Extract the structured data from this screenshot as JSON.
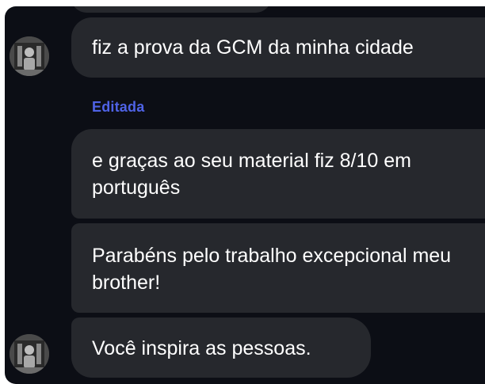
{
  "chat": {
    "messages": [
      {
        "text": "fiz a prova da GCM da minha cidade"
      },
      {
        "text": "e graças ao seu material fiz 8/10 em português"
      },
      {
        "text": "Parabéns pelo trabalho excepcional meu brother!"
      },
      {
        "text": "Você inspira as pessoas."
      }
    ],
    "edited_label": "Editada",
    "avatar_icon": "user-avatar-photo",
    "colors": {
      "background": "#0c0e15",
      "bubble": "#26282d",
      "text": "#ffffff",
      "edited_label": "#4f63e6"
    }
  }
}
